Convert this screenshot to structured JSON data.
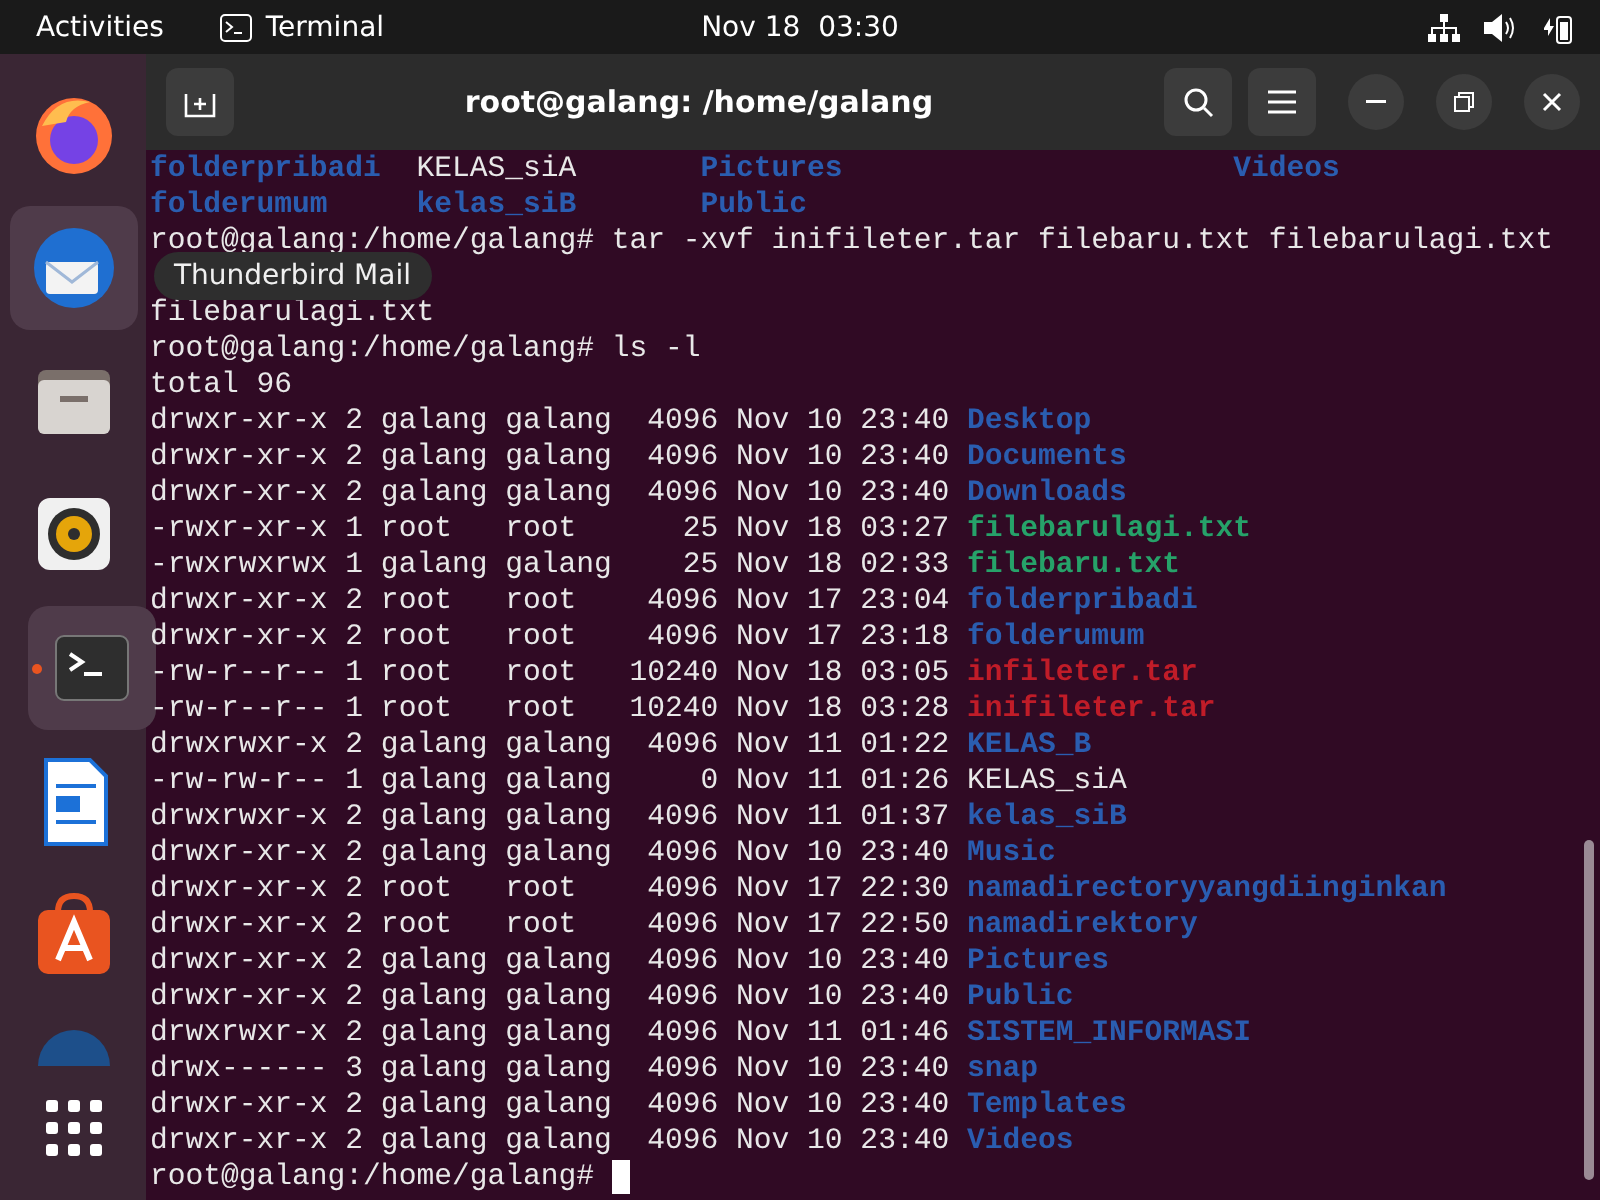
{
  "top_bar": {
    "activities": "Activities",
    "app_name": "Terminal",
    "clock": "Nov 18  03:30"
  },
  "dock": {
    "items": [
      {
        "kind": "firefox",
        "active": false,
        "highlighted": false
      },
      {
        "kind": "mail",
        "active": false,
        "highlighted": true
      },
      {
        "kind": "files",
        "active": false,
        "highlighted": false
      },
      {
        "kind": "music",
        "active": false,
        "highlighted": false
      },
      {
        "kind": "terminal",
        "active": true,
        "highlighted": false
      },
      {
        "kind": "writer",
        "active": false,
        "highlighted": false
      },
      {
        "kind": "store",
        "active": false,
        "highlighted": false
      },
      {
        "kind": "partial",
        "active": false,
        "highlighted": false
      },
      {
        "kind": "apps",
        "active": false,
        "highlighted": false
      }
    ],
    "tooltip": "Thunderbird Mail"
  },
  "window": {
    "title": "root@galang: /home/galang"
  },
  "terminal": {
    "lines": [
      {
        "kind": "columns",
        "segments": [
          {
            "kind": "dir",
            "text": "folderpribadi"
          },
          {
            "kind": "plain",
            "text": "KELAS_siA"
          },
          {
            "kind": "dir",
            "text": "Pictures"
          },
          {
            "kind": "dir",
            "text": "Videos"
          }
        ]
      },
      {
        "kind": "columns",
        "segments": [
          {
            "kind": "dir",
            "text": "folderumum"
          },
          {
            "kind": "dir",
            "text": "kelas_siB"
          },
          {
            "kind": "dir",
            "text": "Public"
          }
        ]
      },
      {
        "segments": [
          {
            "kind": "plain",
            "text": "root@galang:/home/galang# tar -xvf inifileter.tar filebaru.txt filebarulagi.txt"
          }
        ]
      },
      {
        "kind": "covered"
      },
      {
        "segments": [
          {
            "kind": "plain",
            "text": "filebarulagi.txt"
          }
        ]
      },
      {
        "segments": [
          {
            "kind": "plain",
            "text": "root@galang:/home/galang# ls -l"
          }
        ]
      },
      {
        "segments": [
          {
            "kind": "plain",
            "text": "total 96"
          }
        ]
      },
      {
        "segments": [
          {
            "kind": "plain",
            "text": "drwxr-xr-x 2 galang galang  4096 Nov 10 23:40 "
          },
          {
            "kind": "dir",
            "text": "Desktop"
          }
        ]
      },
      {
        "segments": [
          {
            "kind": "plain",
            "text": "drwxr-xr-x 2 galang galang  4096 Nov 10 23:40 "
          },
          {
            "kind": "dir",
            "text": "Documents"
          }
        ]
      },
      {
        "segments": [
          {
            "kind": "plain",
            "text": "drwxr-xr-x 2 galang galang  4096 Nov 10 23:40 "
          },
          {
            "kind": "dir",
            "text": "Downloads"
          }
        ]
      },
      {
        "segments": [
          {
            "kind": "plain",
            "text": "-rwxr-xr-x 1 root   root      25 Nov 18 03:27 "
          },
          {
            "kind": "exec",
            "text": "filebarulagi.txt"
          }
        ]
      },
      {
        "segments": [
          {
            "kind": "plain",
            "text": "-rwxrwxrwx 1 galang galang    25 Nov 18 02:33 "
          },
          {
            "kind": "exec",
            "text": "filebaru.txt"
          }
        ]
      },
      {
        "segments": [
          {
            "kind": "plain",
            "text": "drwxr-xr-x 2 root   root    4096 Nov 17 23:04 "
          },
          {
            "kind": "dir",
            "text": "folderpribadi"
          }
        ]
      },
      {
        "segments": [
          {
            "kind": "plain",
            "text": "drwxr-xr-x 2 root   root    4096 Nov 17 23:18 "
          },
          {
            "kind": "dir",
            "text": "folderumum"
          }
        ]
      },
      {
        "segments": [
          {
            "kind": "plain",
            "text": "-rw-r--r-- 1 root   root   10240 Nov 18 03:05 "
          },
          {
            "kind": "archive",
            "text": "infileter.tar"
          }
        ]
      },
      {
        "segments": [
          {
            "kind": "plain",
            "text": "-rw-r--r-- 1 root   root   10240 Nov 18 03:28 "
          },
          {
            "kind": "archive",
            "text": "inifileter.tar"
          }
        ]
      },
      {
        "segments": [
          {
            "kind": "plain",
            "text": "drwxrwxr-x 2 galang galang  4096 Nov 11 01:22 "
          },
          {
            "kind": "dir",
            "text": "KELAS_B"
          }
        ]
      },
      {
        "segments": [
          {
            "kind": "plain",
            "text": "-rw-rw-r-- 1 galang galang     0 Nov 11 01:26 "
          },
          {
            "kind": "plain",
            "text": "KELAS_siA"
          }
        ]
      },
      {
        "segments": [
          {
            "kind": "plain",
            "text": "drwxrwxr-x 2 galang galang  4096 Nov 11 01:37 "
          },
          {
            "kind": "dir",
            "text": "kelas_siB"
          }
        ]
      },
      {
        "segments": [
          {
            "kind": "plain",
            "text": "drwxr-xr-x 2 galang galang  4096 Nov 10 23:40 "
          },
          {
            "kind": "dir",
            "text": "Music"
          }
        ]
      },
      {
        "segments": [
          {
            "kind": "plain",
            "text": "drwxr-xr-x 2 root   root    4096 Nov 17 22:30 "
          },
          {
            "kind": "dir",
            "text": "namadirectoryyangdiinginkan"
          }
        ]
      },
      {
        "segments": [
          {
            "kind": "plain",
            "text": "drwxr-xr-x 2 root   root    4096 Nov 17 22:50 "
          },
          {
            "kind": "dir",
            "text": "namadirektory"
          }
        ]
      },
      {
        "segments": [
          {
            "kind": "plain",
            "text": "drwxr-xr-x 2 galang galang  4096 Nov 10 23:40 "
          },
          {
            "kind": "dir",
            "text": "Pictures"
          }
        ]
      },
      {
        "segments": [
          {
            "kind": "plain",
            "text": "drwxr-xr-x 2 galang galang  4096 Nov 10 23:40 "
          },
          {
            "kind": "dir",
            "text": "Public"
          }
        ]
      },
      {
        "segments": [
          {
            "kind": "plain",
            "text": "drwxrwxr-x 2 galang galang  4096 Nov 11 01:46 "
          },
          {
            "kind": "dir",
            "text": "SISTEM_INFORMASI"
          }
        ]
      },
      {
        "segments": [
          {
            "kind": "plain",
            "text": "drwx------ 3 galang galang  4096 Nov 10 23:40 "
          },
          {
            "kind": "dir",
            "text": "snap"
          }
        ]
      },
      {
        "segments": [
          {
            "kind": "plain",
            "text": "drwxr-xr-x 2 galang galang  4096 Nov 10 23:40 "
          },
          {
            "kind": "dir",
            "text": "Templates"
          }
        ]
      },
      {
        "segments": [
          {
            "kind": "plain",
            "text": "drwxr-xr-x 2 galang galang  4096 Nov 10 23:40 "
          },
          {
            "kind": "dir",
            "text": "Videos"
          }
        ]
      },
      {
        "segments": [
          {
            "kind": "plain",
            "text": "root@galang:/home/galang# "
          }
        ],
        "cursor": true
      }
    ]
  }
}
